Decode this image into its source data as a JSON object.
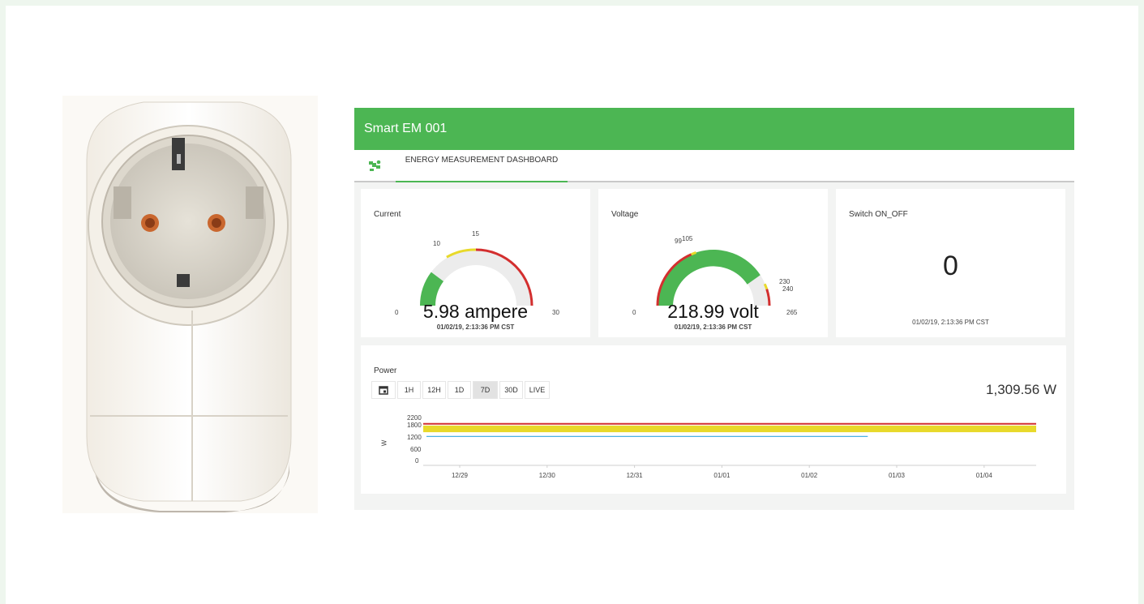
{
  "app": {
    "title": "Smart EM 001"
  },
  "tabs": [
    {
      "label": "ENERGY MEASUREMENT DASHBOARD",
      "icon": "energy-icon",
      "active": true
    }
  ],
  "colors": {
    "header": "#4cb653",
    "gauge_fill": "#4cb653",
    "red": "#d32f2f",
    "yellow": "#e8d92a",
    "line": "#35a7e0"
  },
  "current": {
    "title": "Current",
    "value_text": "5.98 ampere",
    "value": 5.98,
    "min": 0,
    "max": 30,
    "ticks": [
      "0",
      "10",
      "15",
      "30"
    ],
    "timestamp": "01/02/19, 2:13:36 PM CST"
  },
  "voltage": {
    "title": "Voltage",
    "value_text": "218.99 volt",
    "value": 218.99,
    "min": 0,
    "max": 265,
    "ticks": [
      "0",
      "99",
      "105",
      "230",
      "240",
      "265"
    ],
    "timestamp": "01/02/19, 2:13:36 PM CST"
  },
  "switch": {
    "title": "Switch ON_OFF",
    "value": "0",
    "timestamp": "01/02/19, 2:13:36 PM CST"
  },
  "power": {
    "title": "Power",
    "current_value": "1,309.56 W",
    "buttons": [
      "1H",
      "12H",
      "1D",
      "7D",
      "30D",
      "LIVE"
    ],
    "active_button": "7D",
    "calendar_icon": "calendar-icon"
  },
  "chart_data": {
    "type": "line",
    "ylabel": "W",
    "yticks": [
      "2200",
      "1800",
      "1200",
      "600",
      "0"
    ],
    "ylim": [
      0,
      2200
    ],
    "x_ticks": [
      "12/29",
      "12/30",
      "12/31",
      "01/01",
      "01/02",
      "01/03",
      "01/04"
    ],
    "series": [
      {
        "values": [
          1309,
          1309,
          1309,
          1309,
          1309
        ]
      }
    ],
    "threshold_bands": [
      {
        "color": "red",
        "value": 1880
      },
      {
        "color": "yellow",
        "from": 1500,
        "to": 1800
      }
    ]
  }
}
